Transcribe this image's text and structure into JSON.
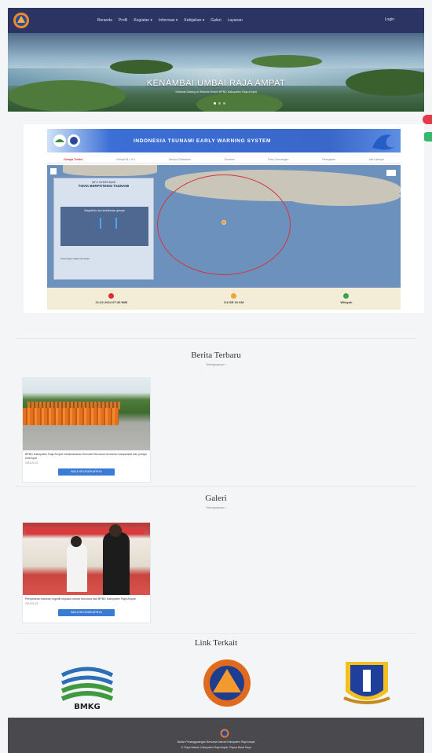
{
  "nav": {
    "items": [
      "Beranda",
      "Profil",
      "Kegiatan ▾",
      "Informasi ▾",
      "Kebijakan ▾",
      "Galeri",
      "Layanan"
    ],
    "login": "Login"
  },
  "hero": {
    "title": "KENAMBAI UMBAI RAJA AMPAT",
    "subtitle": "Selamat Datang di Website Resmi BPBD Kabupaten Raja Ampat"
  },
  "ews": {
    "title": "INDONESIA TSUNAMI EARLY WARNING SYSTEM",
    "tabs": [
      "Gempa Terkini",
      "Gempa M ≥ 5.0",
      "Gempa Dirasakan",
      "Tsunami",
      "Peta Guncangan",
      "Peringatan",
      "Info Lainnya"
    ],
    "info_head": "INFO GEMPA BUMI",
    "info_label": "TIDAK BERPOTENSI TSUNAMI",
    "info_box": "Magnitudo dan kedalaman gempa",
    "info_bottom": "Keterangan skala intensitas",
    "footer": [
      "21-02-2024 07:36 WIB",
      "5.8 SR 10 KM",
      "Wilayah"
    ]
  },
  "news": {
    "title": "Berita Terbaru",
    "subtitle": "Selengkapnya »",
    "card_text": "BPBD Kabupaten Raja Ampat melaksanakan Simulasi Bencana bersama masyarakat dan pelajar setempat",
    "card_date": "2024-02-21",
    "card_btn": "BACA SELENGKAPNYA"
  },
  "gallery": {
    "title": "Galeri",
    "subtitle": "Selengkapnya »",
    "card_text": "Penyerahan bantuan logistik kepada korban bencana dari BPBD Kabupaten Raja Ampat",
    "card_date": "2024-01-15",
    "card_btn": "BACA SELENGKAPNYA"
  },
  "links": {
    "title": "Link Terkait",
    "bmkg_label": "BMKG"
  },
  "footer": {
    "line1": "Badan Penanggulangan Bencana Daerah Kabupaten Raja Ampat",
    "line2": "Jl. Raya Waisai, Kabupaten Raja Ampat, Papua Barat Daya"
  },
  "colors": {
    "navbar": "#2b3462",
    "ews_blue": "#3a67c9",
    "accent_btn": "#3a7bd5",
    "float_red": "#e23b4b",
    "float_green": "#36b86a",
    "footer": "#4a4a4e"
  }
}
